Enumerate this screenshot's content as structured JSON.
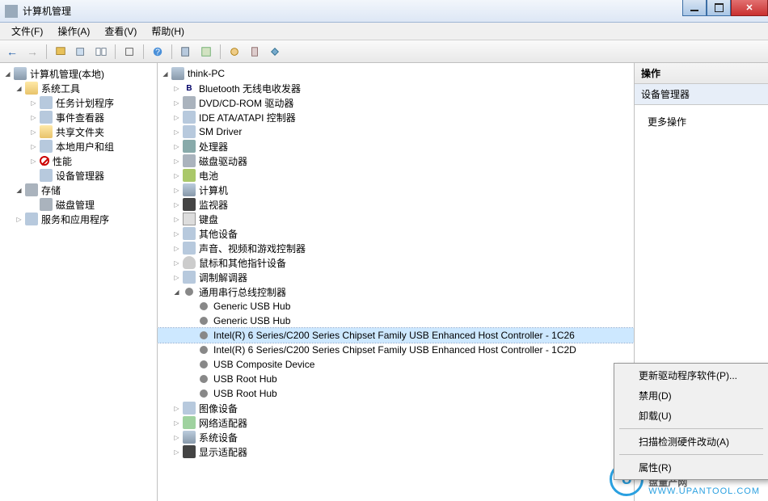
{
  "window": {
    "title": "计算机管理"
  },
  "menu": {
    "file": "文件(F)",
    "action": "操作(A)",
    "view": "查看(V)",
    "help": "帮助(H)"
  },
  "left_tree": {
    "root": "计算机管理(本地)",
    "sys_tools": "系统工具",
    "task_scheduler": "任务计划程序",
    "event_viewer": "事件查看器",
    "shared_folders": "共享文件夹",
    "local_users": "本地用户和组",
    "performance": "性能",
    "device_manager": "设备管理器",
    "storage": "存储",
    "disk_mgmt": "磁盘管理",
    "services_apps": "服务和应用程序"
  },
  "center_root": "think-PC",
  "categories": {
    "bluetooth": "Bluetooth 无线电收发器",
    "dvd": "DVD/CD-ROM 驱动器",
    "ide": "IDE ATA/ATAPI 控制器",
    "sm": "SM Driver",
    "cpu": "处理器",
    "diskdrv": "磁盘驱动器",
    "battery": "电池",
    "computer": "计算机",
    "monitor": "监视器",
    "keyboard": "键盘",
    "other": "其他设备",
    "sound": "声音、视频和游戏控制器",
    "mouse": "鼠标和其他指针设备",
    "modem": "调制解调器",
    "usb_ctrl": "通用串行总线控制器",
    "image": "图像设备",
    "netadapter": "网络适配器",
    "sysdev": "系统设备",
    "display": "显示适配器"
  },
  "usb_nodes": {
    "hub1": "Generic USB Hub",
    "hub2": "Generic USB Hub",
    "intel1": "Intel(R) 6 Series/C200 Series Chipset Family USB Enhanced Host Controller - 1C26",
    "intel2": "Intel(R) 6 Series/C200 Series Chipset Family USB Enhanced Host Controller - 1C2D",
    "composite": "USB Composite Device",
    "root1": "USB Root Hub",
    "root2": "USB Root Hub"
  },
  "right": {
    "header": "操作",
    "sub": "设备管理器",
    "more": "更多操作"
  },
  "context": {
    "update": "更新驱动程序软件(P)...",
    "disable": "禁用(D)",
    "uninstall": "卸载(U)",
    "scan": "扫描检测硬件改动(A)",
    "properties": "属性(R)"
  },
  "watermark": {
    "text": "盘量产网",
    "url": "WWW.UPANTOOL.COM",
    "logo": "U"
  }
}
